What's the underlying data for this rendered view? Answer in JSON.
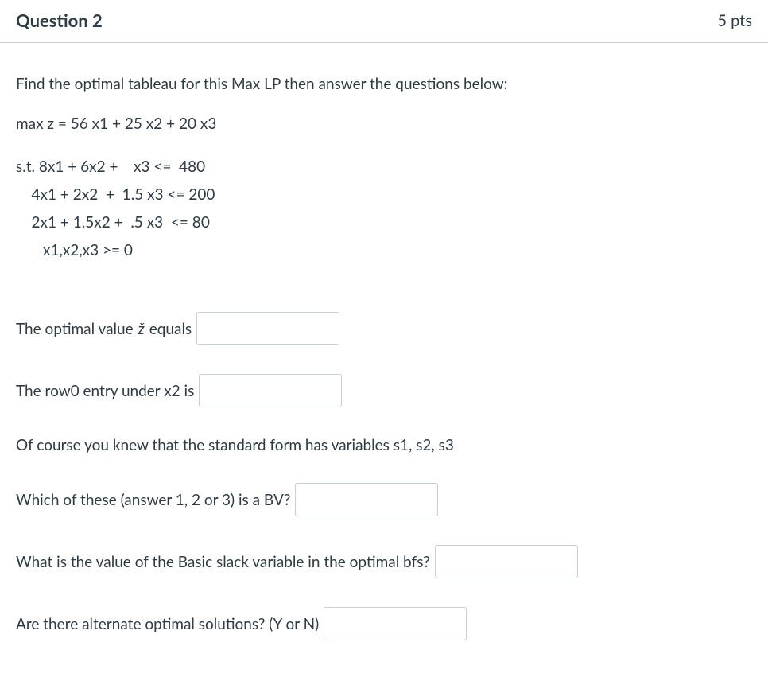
{
  "header": {
    "title": "Question 2",
    "points": "5 pts"
  },
  "prompt": "Find the optimal tableau for this Max LP then answer the questions below:",
  "objective": "max z = 56 x1 + 25 x2 + 20 x3",
  "constraints": {
    "c1": "s.t. 8x1 + 6x2 +    x3 <=  480",
    "c2": "    4x1 + 2x2  +  1.5 x3 <= 200",
    "c3": "    2x1 + 1.5x2 +  .5 x3  <= 80",
    "c4": "       x1,x2,x3 >= 0"
  },
  "q1": {
    "label_pre": "The optimal value ",
    "zhat": "ž",
    "label_post": " equals"
  },
  "q2": {
    "label": "The row0  entry under  x2  is"
  },
  "note": "Of course you knew that the standard form has variables  s1, s2, s3",
  "q3": {
    "label": "Which of these (answer 1, 2 or 3)  is a  BV?"
  },
  "q4": {
    "label": "What is the value of the Basic slack variable in the optimal bfs?"
  },
  "q5": {
    "label": "Are there alternate optimal solutions?  (Y or N)"
  }
}
